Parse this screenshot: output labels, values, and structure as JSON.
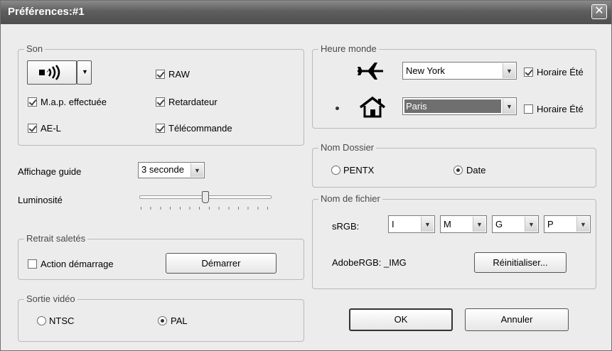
{
  "window": {
    "title": "Préférences:#1",
    "close_glyph": "✕"
  },
  "son": {
    "label": "Son",
    "speaker_icon": "speaker-icon",
    "checkboxes": [
      {
        "label": "RAW",
        "checked": true
      },
      {
        "label": "M.a.p. effectuée",
        "checked": true
      },
      {
        "label": "Retardateur",
        "checked": true
      },
      {
        "label": "AE-L",
        "checked": true
      },
      {
        "label": "Télécommande",
        "checked": true
      }
    ]
  },
  "affichage_guide": {
    "label": "Affichage guide",
    "value": "3 seconde"
  },
  "luminosite": {
    "label": "Luminosité",
    "level": 0.5
  },
  "retrait": {
    "label": "Retrait saletés",
    "action_label": "Action démarrage",
    "action_checked": false,
    "button": "Démarrer"
  },
  "video": {
    "label": "Sortie vidéo",
    "options": [
      "NTSC",
      "PAL"
    ],
    "selected": "PAL"
  },
  "heure": {
    "label": "Heure monde",
    "rows": [
      {
        "icon": "airplane-icon",
        "city": "New York",
        "dst_label": "Horaire Été",
        "dst_checked": true,
        "selected": false
      },
      {
        "icon": "home-icon",
        "city": "Paris",
        "dst_label": "Horaire Été",
        "dst_checked": false,
        "selected": true
      }
    ]
  },
  "dossier": {
    "label": "Nom Dossier",
    "options": [
      "PENTX",
      "Date"
    ],
    "selected": "Date"
  },
  "fichier": {
    "label": "Nom de fichier",
    "srgb_label": "sRGB:",
    "chars": [
      "I",
      "M",
      "G",
      "P"
    ],
    "adobe_label": "AdobeRGB: _IMG",
    "reset_button": "Réinitialiser..."
  },
  "buttons": {
    "ok": "OK",
    "cancel": "Annuler"
  }
}
